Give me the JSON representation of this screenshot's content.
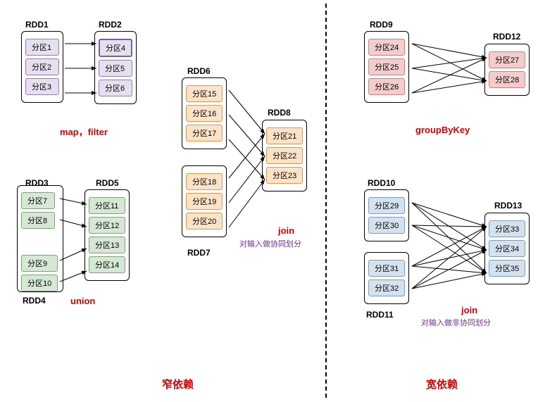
{
  "titles": {
    "narrow": "窄依赖",
    "wide": "宽依赖"
  },
  "ops": {
    "mapfilter": "map，filter",
    "union": "union",
    "join1": "join",
    "join1_sub": "对输入做协同划分",
    "groupbykey": "groupByKey",
    "join2": "join",
    "join2_sub": "对输入做非协同划分"
  },
  "rdds": {
    "rdd1": {
      "label": "RDD1",
      "parts": [
        "分区1",
        "分区2",
        "分区3"
      ]
    },
    "rdd2": {
      "label": "RDD2",
      "parts": [
        "分区4",
        "分区5",
        "分区6"
      ]
    },
    "rdd3": {
      "label": "RDD3",
      "parts": [
        "分区7",
        "分区8"
      ]
    },
    "rdd4": {
      "label": "RDD4",
      "parts": [
        "分区9",
        "分区10"
      ]
    },
    "rdd5": {
      "label": "RDD5",
      "parts": [
        "分区11",
        "分区12",
        "分区13",
        "分区14"
      ]
    },
    "rdd6": {
      "label": "RDD6",
      "parts": [
        "分区15",
        "分区16",
        "分区17"
      ]
    },
    "rdd7": {
      "label": "RDD7",
      "parts": [
        "分区18",
        "分区19",
        "分区20"
      ]
    },
    "rdd8": {
      "label": "RDD8",
      "parts": [
        "分区21",
        "分区22",
        "分区23"
      ]
    },
    "rdd9": {
      "label": "RDD9",
      "parts": [
        "分区24",
        "分区25",
        "分区26"
      ]
    },
    "rdd10": {
      "label": "RDD10",
      "parts": [
        "分区29",
        "分区30"
      ]
    },
    "rdd11": {
      "label": "RDD11",
      "parts": [
        "分区31",
        "分区32"
      ]
    },
    "rdd12": {
      "label": "RDD12",
      "parts": [
        "分区27",
        "分区28"
      ]
    },
    "rdd13": {
      "label": "RDD13",
      "parts": [
        "分区33",
        "分区34",
        "分区35"
      ]
    }
  },
  "chart_data": {
    "type": "diagram",
    "title": "RDD Dependencies: Narrow vs Wide",
    "narrow_dependencies": [
      {
        "op": "map/filter",
        "from": "RDD1",
        "to": "RDD2",
        "edges": [
          [
            "分区1",
            "分区4"
          ],
          [
            "分区2",
            "分区5"
          ],
          [
            "分区3",
            "分区6"
          ]
        ]
      },
      {
        "op": "union",
        "from": [
          "RDD3",
          "RDD4"
        ],
        "to": "RDD5",
        "edges": [
          [
            "分区7",
            "分区11"
          ],
          [
            "分区8",
            "分区12"
          ],
          [
            "分区9",
            "分区13"
          ],
          [
            "分区10",
            "分区14"
          ]
        ]
      },
      {
        "op": "join (co-partitioned)",
        "from": [
          "RDD6",
          "RDD7"
        ],
        "to": "RDD8",
        "edges": [
          [
            "分区15",
            "分区21"
          ],
          [
            "分区16",
            "分区22"
          ],
          [
            "分区17",
            "分区23"
          ],
          [
            "分区18",
            "分区21"
          ],
          [
            "分区19",
            "分区22"
          ],
          [
            "分区20",
            "分区23"
          ]
        ]
      }
    ],
    "wide_dependencies": [
      {
        "op": "groupByKey",
        "from": "RDD9",
        "to": "RDD12",
        "edges": [
          [
            "分区24",
            "分区27"
          ],
          [
            "分区24",
            "分区28"
          ],
          [
            "分区25",
            "分区27"
          ],
          [
            "分区25",
            "分区28"
          ],
          [
            "分区26",
            "分区27"
          ],
          [
            "分区26",
            "分区28"
          ]
        ]
      },
      {
        "op": "join (not co-partitioned)",
        "from": [
          "RDD10",
          "RDD11"
        ],
        "to": "RDD13",
        "edges": [
          [
            "分区29",
            "分区33"
          ],
          [
            "分区29",
            "分区34"
          ],
          [
            "分区29",
            "分区35"
          ],
          [
            "分区30",
            "分区33"
          ],
          [
            "分区30",
            "分区34"
          ],
          [
            "分区30",
            "分区35"
          ],
          [
            "分区31",
            "分区33"
          ],
          [
            "分区31",
            "分区34"
          ],
          [
            "分区31",
            "分区35"
          ],
          [
            "分区32",
            "分区33"
          ],
          [
            "分区32",
            "分区34"
          ],
          [
            "分区32",
            "分区35"
          ]
        ]
      }
    ]
  }
}
